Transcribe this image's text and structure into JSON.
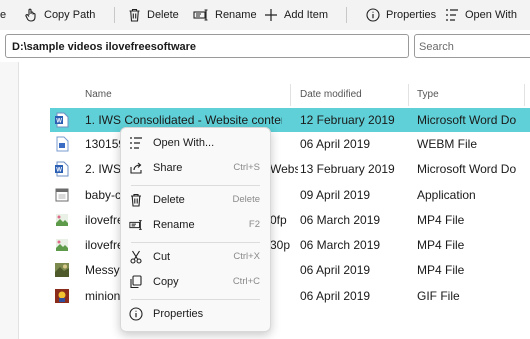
{
  "toolbar": {
    "partial_label": "e",
    "copy_path": "Copy Path",
    "delete": "Delete",
    "rename": "Rename",
    "add_item": "Add Item",
    "properties": "Properties",
    "open_with": "Open With"
  },
  "address": {
    "path": "D:\\sample videos ilovefreesoftware"
  },
  "search": {
    "placeholder": "Search"
  },
  "columns": {
    "name": "Name",
    "date": "Date modified",
    "type": "Type"
  },
  "files": [
    {
      "name": "1. IWS Consolidated - Website conten",
      "date": "12 February 2019",
      "type": "Microsoft Word Do",
      "icon": "word-doc-icon"
    },
    {
      "name": "130159",
      "date": "06 April 2019",
      "type": "WEBM File",
      "icon": "webm-file-icon"
    },
    {
      "name": "2. IWS",
      "name_tail": "Website c",
      "date": "13 February 2019",
      "type": "Microsoft Word Do",
      "icon": "word-doc-icon"
    },
    {
      "name": "baby-c",
      "date": "09 April 2019",
      "type": "Application",
      "icon": "application-icon"
    },
    {
      "name": "ilovefre",
      "name_tail": "0fp",
      "date": "06 March 2019",
      "type": "MP4 File",
      "icon": "mp4-file-icon"
    },
    {
      "name": "ilovefre",
      "name_tail": "30p",
      "date": "06 March 2019",
      "type": "MP4 File",
      "icon": "mp4-file-icon"
    },
    {
      "name": "MessyC",
      "date": "06 April 2019",
      "type": "MP4 File",
      "icon": "video-thumbnail-icon"
    },
    {
      "name": "minion",
      "date": "06 April 2019",
      "type": "GIF File",
      "icon": "gif-thumbnail-icon"
    }
  ],
  "context_menu": {
    "open_with": "Open With...",
    "share": "Share",
    "share_shortcut": "Ctrl+S",
    "delete": "Delete",
    "delete_shortcut": "Delete",
    "rename": "Rename",
    "rename_shortcut": "F2",
    "cut": "Cut",
    "cut_shortcut": "Ctrl+X",
    "copy": "Copy",
    "copy_shortcut": "Ctrl+C",
    "properties": "Properties"
  },
  "colors": {
    "selection": "#5fd0d7",
    "toolbar_bg": "#f3f3f3",
    "menu_bg": "#f9f9f9"
  }
}
